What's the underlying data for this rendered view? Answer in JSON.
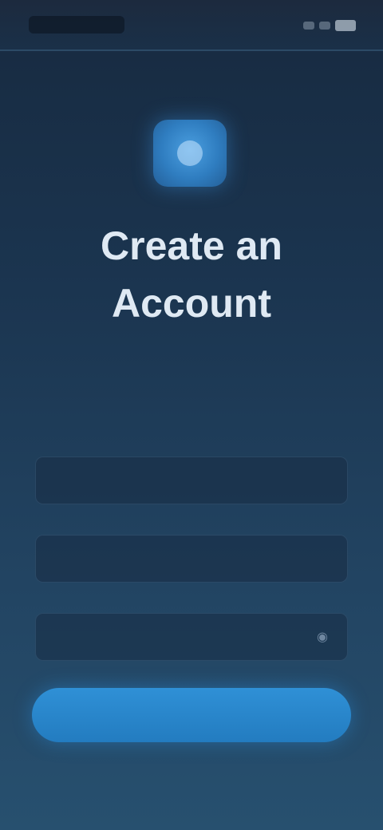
{
  "status_bar": {
    "time": "",
    "battery_icon": "battery-icon"
  },
  "logo": {
    "icon": "app-logo-icon",
    "color": "#2f7dc0"
  },
  "header": {
    "title": "Create an Account",
    "subtitle": ""
  },
  "form": {
    "name_placeholder": "",
    "email_placeholder": "",
    "password_placeholder": "",
    "password_toggle_icon": "eye-icon"
  },
  "actions": {
    "primary_label": "",
    "primary_color": "#2f90d6",
    "secondary_label": ""
  }
}
